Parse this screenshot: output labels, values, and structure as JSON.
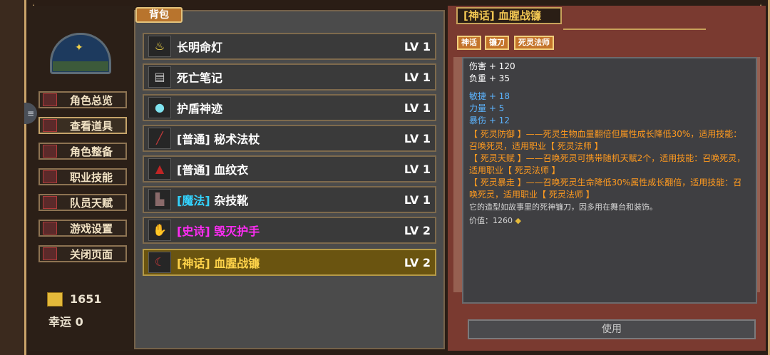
{
  "menu": {
    "items": [
      {
        "label": "角色总览",
        "icon": "character-overview-icon"
      },
      {
        "label": "查看道具",
        "icon": "items-icon",
        "active": true
      },
      {
        "label": "角色整备",
        "icon": "equip-icon"
      },
      {
        "label": "职业技能",
        "icon": "skills-icon"
      },
      {
        "label": "队员天赋",
        "icon": "talent-icon"
      },
      {
        "label": "游戏设置",
        "icon": "settings-icon"
      },
      {
        "label": "关闭页面",
        "icon": "close-page-icon"
      }
    ],
    "side_tab": "≡"
  },
  "currency": {
    "gold": "1651",
    "luck": "幸运 0"
  },
  "bag": {
    "tab_label": "背包",
    "items": [
      {
        "quality": "",
        "name": "长明命灯",
        "level": "LV 1",
        "icon": "lamp-icon",
        "quality_color": "#ffffff"
      },
      {
        "quality": "",
        "name": "死亡笔记",
        "level": "LV 1",
        "icon": "book-icon",
        "quality_color": "#ffffff"
      },
      {
        "quality": "",
        "name": "护盾神迹",
        "level": "LV 1",
        "icon": "orb-icon",
        "quality_color": "#ffffff"
      },
      {
        "quality": "[普通]",
        "name": "秘术法杖",
        "level": "LV 1",
        "icon": "staff-icon",
        "quality_color": "#ffffff"
      },
      {
        "quality": "[普通]",
        "name": "血纹衣",
        "level": "LV 1",
        "icon": "robe-icon",
        "quality_color": "#ffffff"
      },
      {
        "quality": "[魔法]",
        "name": "杂技靴",
        "level": "LV 1",
        "icon": "boots-icon",
        "quality_color": "#33d3ff"
      },
      {
        "quality": "[史诗]",
        "name": "毁灭护手",
        "level": "LV 2",
        "icon": "gauntlet-icon",
        "quality_color": "#ff2cf5"
      },
      {
        "quality": "[神话]",
        "name": "血腥战镰",
        "level": "LV 2",
        "icon": "scythe-icon",
        "quality_color": "#ffd34a",
        "selected": true
      }
    ]
  },
  "detail": {
    "title": "[神话] 血腥战镰",
    "tags": [
      "神话",
      "镰刀",
      "死灵法师"
    ],
    "base_stats": [
      "伤害 + 120",
      "负重 + 35"
    ],
    "bonus_stats": [
      "敏捷 + 18",
      "力量 + 5",
      "暴伤 + 12"
    ],
    "effects": [
      "【 死灵防御 】——死灵生物血量翻倍但属性成长降低30%，适用技能：召唤死灵，适用职业【 死灵法师 】",
      "【 死灵天赋 】——召唤死灵可携带随机天赋2个，适用技能：召唤死灵，适用职业【 死灵法师 】",
      "【 死灵暴走 】——召唤死灵生命降低30%属性成长翻倍，适用技能：召唤死灵，适用职业【 死灵法师 】"
    ],
    "flavor": "它的造型如故事里的死神镰刀，因多用在舞台和装饰。",
    "value": "价值：1260",
    "use_label": "使用"
  },
  "colors": {
    "accent": "#c8a25a",
    "selected_row": "#6a5410",
    "mythic": "#ffd34a",
    "epic": "#ff2cf5",
    "magic": "#33d3ff",
    "effect": "#ff9a1f",
    "bonus": "#5cb4ff"
  }
}
